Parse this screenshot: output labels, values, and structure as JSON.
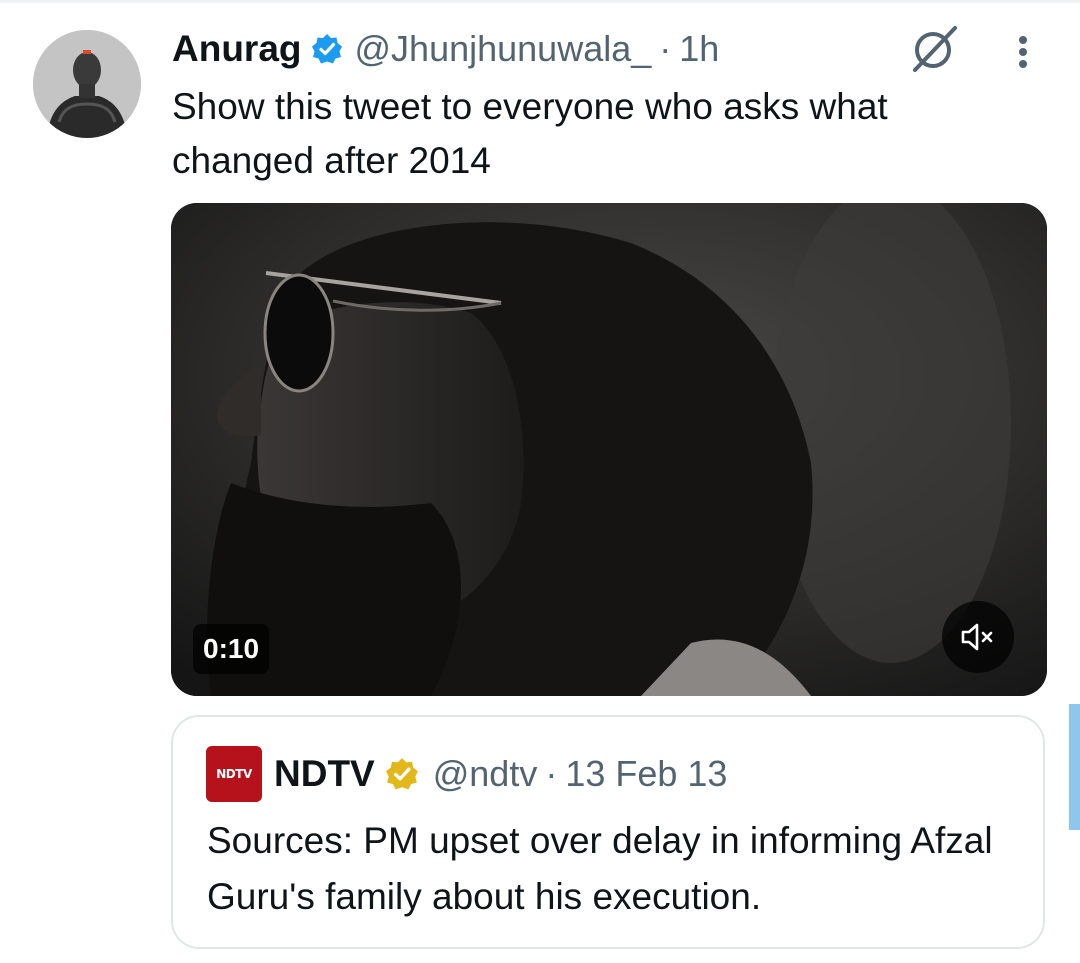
{
  "tweet": {
    "author": {
      "display_name": "Anurag",
      "handle": "@Jhunjhunuwala_",
      "verified": true,
      "avatar_icon": "avatar-image"
    },
    "separator": "·",
    "time": "1h",
    "text": "Show this tweet to everyone who asks what changed after 2014",
    "actions": {
      "grok_icon": "grok-icon",
      "more_icon": "more-options-icon"
    },
    "video": {
      "duration": "0:10",
      "muted": true,
      "mute_icon": "volume-muted-icon"
    }
  },
  "quoted_tweet": {
    "author": {
      "display_name": "NDTV",
      "handle": "@ndtv",
      "logo_text": "NDTV",
      "verified_type": "gold"
    },
    "separator": "·",
    "date": "13 Feb 13",
    "text": "Sources: PM upset over delay in informing Afzal Guru's family about his execution."
  },
  "colors": {
    "text_primary": "#0f1419",
    "text_secondary": "#536471",
    "verified_blue": "#1d9bf0",
    "verified_gold": "#e2b719",
    "ndtv_red": "#b5121b",
    "card_border": "#e1e6e9"
  }
}
